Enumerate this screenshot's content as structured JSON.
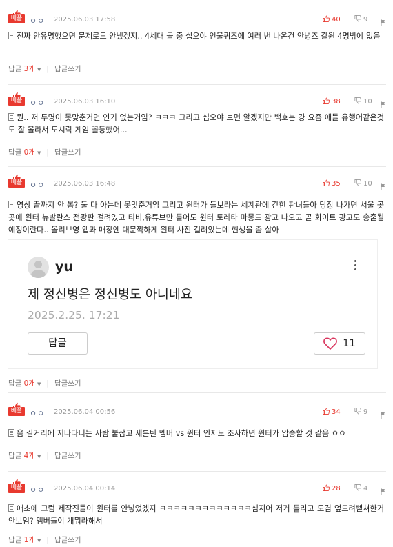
{
  "comments": [
    {
      "badge": "베플",
      "nick": "ㅇㅇ",
      "date": "2025.06.03 17:58",
      "up": "40",
      "down": "9",
      "text": "진짜 안유명했으면 문제로도 안냈겠지.. 4세대 돌 중 십오야 인물퀴즈에 여러 번 나온건 안녕즈 칼윈 4명밖에 없음",
      "replies_label": "답글",
      "replies_count": "3개",
      "write_label": "답글쓰기"
    },
    {
      "badge": "베플",
      "nick": "ㅇㅇ",
      "date": "2025.06.03 16:10",
      "up": "38",
      "down": "10",
      "text": "뭔.. 저 두명이 못맞춘거면 인기 없는거임? ㅋㅋㅋ 그리고 십오야 보면 알겠지만 백호는 걍 요즘 애들 유행어같은것도 잘 몰라서 도시락 게임 꼴등했어...",
      "replies_label": "답글",
      "replies_count": "0개",
      "write_label": "답글쓰기"
    },
    {
      "badge": "베플",
      "nick": "ㅇㅇ",
      "date": "2025.06.03 16:48",
      "up": "35",
      "down": "10",
      "text": "영상 끝까지 안 봄? 둘 다 아는데 못맞춘거임 그리고 윈터가 들보라는 세계관에 갇힌 판녀들아 당장 나가면 서울 곳곳에 윈터 뉴발란스 전광판 걸려있고 티비,유튜브만 틀어도 윈터 토레타 마몽드 광고 나오고 곧 화이트 광고도 송출될 예정이란다.. 올리브영 앱과 매장엔 대문짝하게 윈터 사진 걸려있는데 현생을 좀 살아",
      "replies_label": "답글",
      "replies_count": "0개",
      "write_label": "답글쓰기",
      "embed": {
        "name": "yu",
        "text": "제 정신병은 정신병도 아니네요",
        "date": "2025.2.25. 17:21",
        "reply_label": "답글",
        "likes": "11"
      }
    },
    {
      "badge": "베플",
      "nick": "ㅇㅇ",
      "date": "2025.06.04 00:56",
      "up": "34",
      "down": "9",
      "text": "음 길거리에 지나다니는 사람 붙잡고 세븐틴 멤버 vs 윈터 인지도 조사하면 윈터가 압승할 것 같음 ㅇㅇ",
      "replies_label": "답글",
      "replies_count": "4개",
      "write_label": "답글쓰기"
    },
    {
      "badge": "베플",
      "nick": "ㅇㅇ",
      "date": "2025.06.04 00:14",
      "up": "28",
      "down": "4",
      "text": "애초에 그럼 제작진들이 윈터를 안넣었겠지 ㅋㅋㅋㅋㅋㅋㅋㅋㅋㅋㅋㅋㅋ심지어 저거 틀리고 도겸 엎드려뻗쳐한거 안보임? 맴버들이 개뭐라해서",
      "replies_label": "답글",
      "replies_count": "1개",
      "write_label": "답글쓰기"
    }
  ],
  "icons": {
    "thumb": "thumbs-up-icon",
    "up": "thumbs-up-icon",
    "down": "thumbs-down-icon",
    "report": "report-icon",
    "doc": "document-icon",
    "more": "more-vertical-icon",
    "heart": "heart-icon"
  },
  "colors": {
    "accent": "#e8392f",
    "nick": "#5a6a8a",
    "muted": "#999999"
  }
}
